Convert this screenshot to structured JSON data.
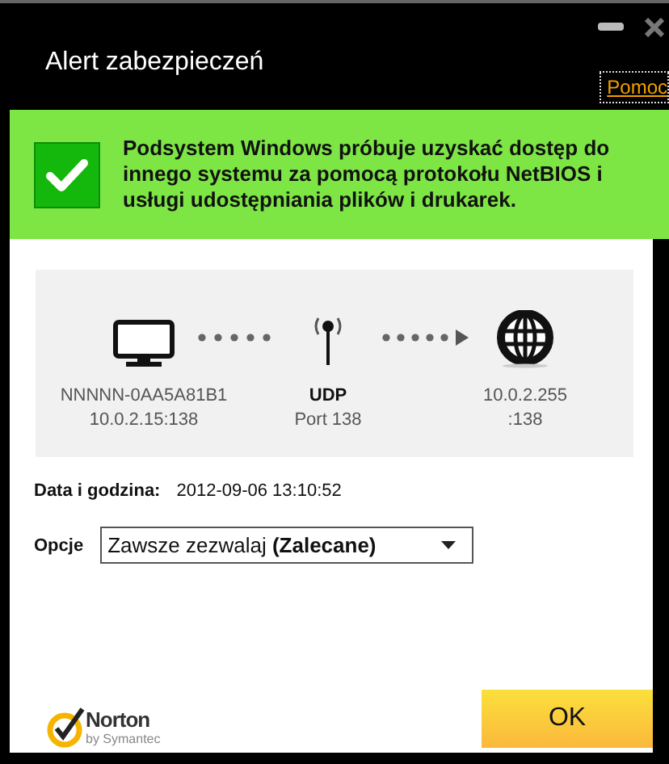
{
  "window": {
    "title": "Alert zabezpieczeń",
    "help_link": "Pomoc"
  },
  "alert": {
    "message": "Podsystem Windows próbuje uzyskać dostęp do innego systemu za pomocą protokołu NetBIOS i usługi udostępniania plików i drukarek."
  },
  "connection": [
    {
      "kind": "computer",
      "lines": [
        "NNNNN-0AA5A81B1",
        "10.0.2.15:138"
      ]
    },
    {
      "kind": "protocol",
      "lines": [
        "UDP",
        "Port 138"
      ]
    },
    {
      "kind": "network",
      "lines": [
        "10.0.2.255",
        ":138"
      ]
    }
  ],
  "details": {
    "label": "Data i godzina:",
    "value": "2012-09-06 13:10:52"
  },
  "options": {
    "label": "Opcje",
    "value": "Zawsze zezwalaj  **(Zalecane)**"
  },
  "brand": {
    "name": "Norton",
    "tagline": "by Symantec"
  },
  "buttons": [
    "OK"
  ]
}
